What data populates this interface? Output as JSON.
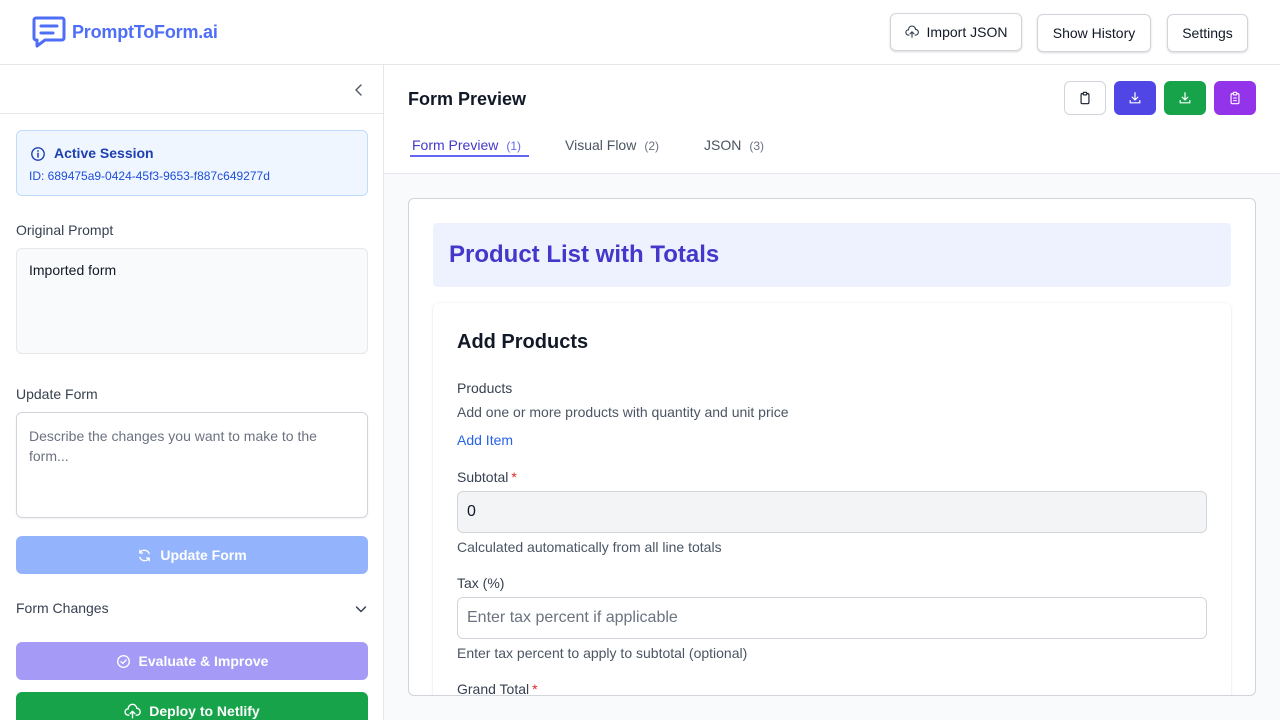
{
  "app": {
    "brand": "PromptToForm.ai",
    "brand_color": "#4f6ef7"
  },
  "header": {
    "import_label": "Import JSON",
    "history_label": "Show History",
    "settings_label": "Settings"
  },
  "sidebar": {
    "session_title": "Active Session",
    "session_id": "ID: 689475a9-0424-45f3-9653-f887c649277d",
    "original_prompt_label": "Original Prompt",
    "original_prompt_value": "Imported form",
    "update_form_label": "Update Form",
    "update_placeholder": "Describe the changes you want to make to the form...",
    "update_button": "Update Form",
    "form_changes_label": "Form Changes",
    "evaluate_button": "Evaluate & Improve",
    "deploy_button": "Deploy to Netlify"
  },
  "main": {
    "title": "Form Preview",
    "tabs": [
      {
        "label": "Form Preview",
        "count": "(1)"
      },
      {
        "label": "Visual Flow",
        "count": "(2)"
      },
      {
        "label": "JSON",
        "count": "(3)"
      }
    ]
  },
  "form": {
    "title": "Product List with Totals",
    "section_title": "Add Products",
    "products_label": "Products",
    "products_help": "Add one or more products with quantity and unit price",
    "add_item": "Add Item",
    "subtotal_label": "Subtotal",
    "subtotal_value": "0",
    "subtotal_help": "Calculated automatically from all line totals",
    "tax_label": "Tax (%)",
    "tax_placeholder": "Enter tax percent if applicable",
    "tax_help": "Enter tax percent to apply to subtotal (optional)",
    "grand_total_label": "Grand Total",
    "required_mark": "*"
  }
}
